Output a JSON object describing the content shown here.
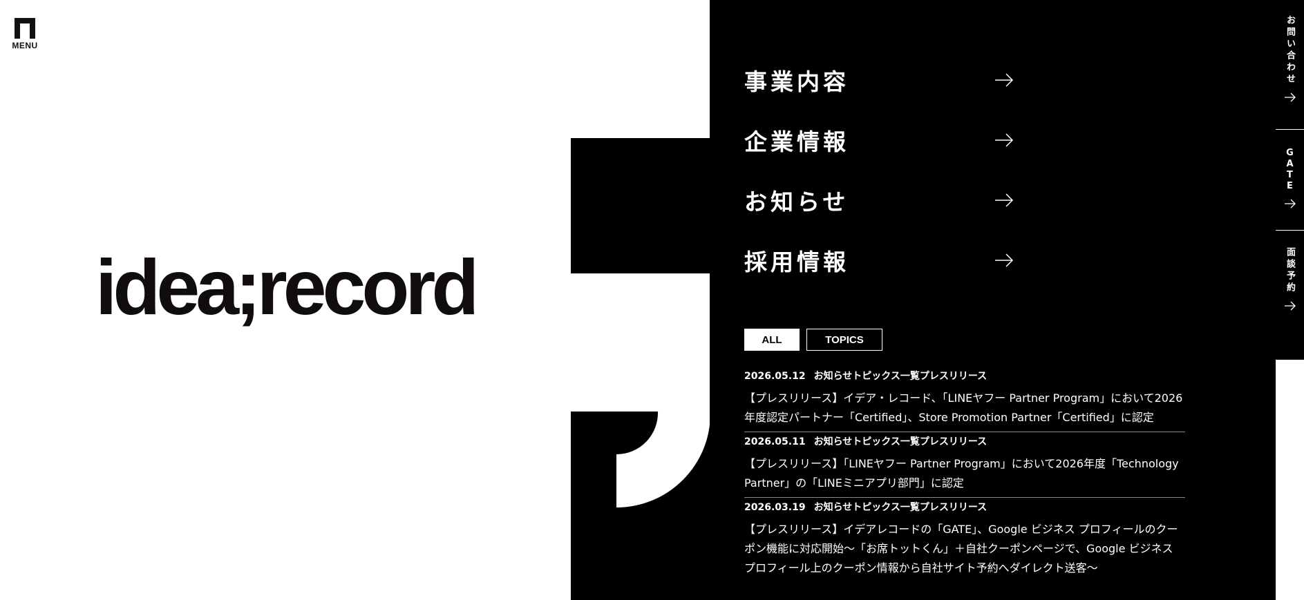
{
  "header": {
    "menu_label": "MENU",
    "logo_text": "idea;record"
  },
  "nav": {
    "items": [
      {
        "label": "事業内容",
        "icon": "arrow-right-icon"
      },
      {
        "label": "企業情報",
        "icon": "arrow-right-icon"
      },
      {
        "label": "お知らせ",
        "icon": "arrow-right-icon"
      },
      {
        "label": "採用情報",
        "icon": "arrow-right-icon"
      }
    ]
  },
  "news": {
    "tabs": [
      {
        "label": "ALL",
        "active": true
      },
      {
        "label": "TOPICS",
        "active": false
      }
    ],
    "items": [
      {
        "date": "2026.05.12",
        "categories": "お知らせトピックス一覧プレスリリース",
        "title": "【プレスリリース】イデア・レコード、「LINEヤフー Partner Program」において2026年度認定パートナー「Certified」、Store Promotion Partner「Certified」に認定"
      },
      {
        "date": "2026.05.11",
        "categories": "お知らせトピックス一覧プレスリリース",
        "title": "【プレスリリース】「LINEヤフー Partner Program」において2026年度「Technology Partner」の「LINEミニアプリ部門」に認定"
      },
      {
        "date": "2026.03.19",
        "categories": "お知らせトピックス一覧プレスリリース",
        "title": "【プレスリリース】イデアレコードの「GATE」、Google ビジネス プロフィールのクーポン機能に対応開始〜「お席トットくん」＋自社クーポンページで、Google ビジネス プロフィール上のクーポン情報から自社サイト予約へダイレクト送客〜"
      }
    ]
  },
  "sidebar": {
    "items": [
      {
        "label": "お問い合わせ",
        "icon": "arrow-right-icon"
      },
      {
        "label": "GATE",
        "letters": [
          "G",
          "A",
          "T",
          "E"
        ],
        "icon": "arrow-right-icon"
      },
      {
        "label": "面談予約",
        "icon": "arrow-right-icon"
      }
    ]
  },
  "colors": {
    "background": "#ffffff",
    "panel": "#000000",
    "text_dark": "#120d0d",
    "text_light": "#ffffff"
  }
}
